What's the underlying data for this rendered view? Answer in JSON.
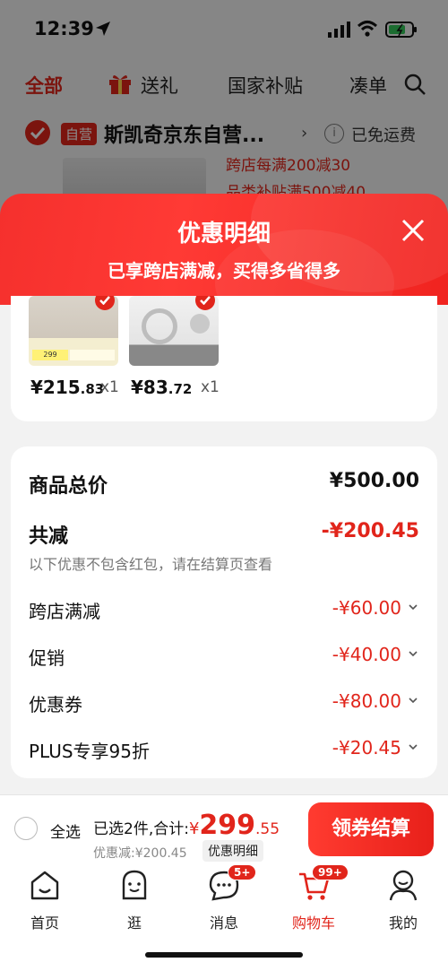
{
  "status": {
    "time": "12:39"
  },
  "top_tabs": {
    "all": "全部",
    "gift": "送礼",
    "subsidy": "国家补贴",
    "more": "凑单"
  },
  "store": {
    "badge": "自营",
    "name": "斯凯奇京东自营...",
    "shipping": "已免运费"
  },
  "promos": {
    "line1": "跨店每满200减30",
    "line2": "品类补贴满500减40"
  },
  "sheet": {
    "title": "优惠明细",
    "subtitle": "已享跨店满减，买得多省得多"
  },
  "products": [
    {
      "price_int": "¥215",
      "price_dec": ".83",
      "qty": "x1",
      "tag": "299"
    },
    {
      "price_int": "¥83",
      "price_dec": ".72",
      "qty": "x1"
    }
  ],
  "summary": {
    "total_label": "商品总价",
    "total_value": "¥500.00",
    "reduce_label": "共减",
    "reduce_value": "-¥200.45",
    "note": "以下优惠不包含红包，请在结算页查看",
    "details": [
      {
        "label": "跨店满减",
        "value": "-¥60.00"
      },
      {
        "label": "促销",
        "value": "-¥40.00"
      },
      {
        "label": "优惠券",
        "value": "-¥80.00"
      },
      {
        "label": "PLUS专享95折",
        "value": "-¥20.45"
      }
    ]
  },
  "checkout": {
    "select_all": "全选",
    "selected_text": "已选2件,合计:",
    "currency": "¥",
    "amount_int": "299",
    "amount_dec": ".55",
    "saved_text": "优惠减:¥200.45",
    "detail_label": "优惠明细",
    "pay_label": "领券结算"
  },
  "nav": {
    "home": "首页",
    "guang": "逛",
    "msg": "消息",
    "cart": "购物车",
    "me": "我的",
    "msg_badge": "5+",
    "cart_badge": "99+"
  },
  "colors": {
    "accent": "#e1251b"
  }
}
